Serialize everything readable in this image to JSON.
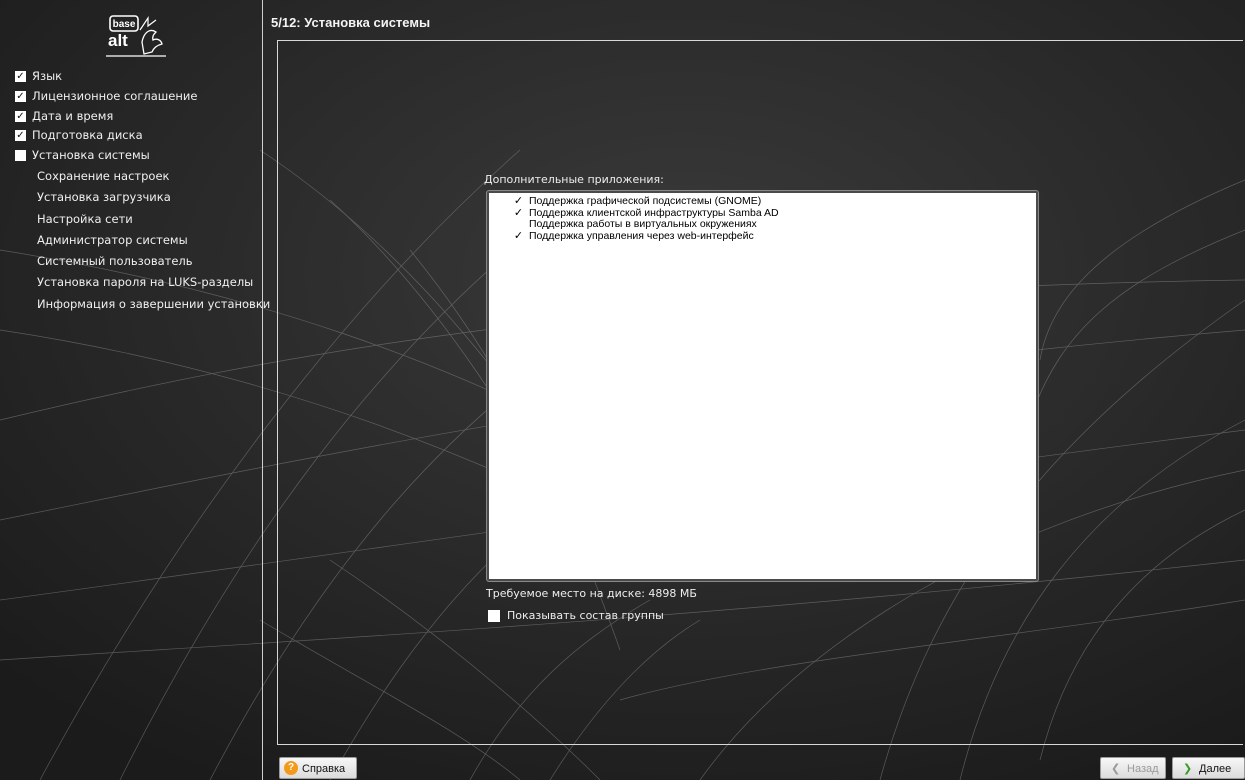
{
  "logo": {
    "line1": "base",
    "line2": "alt"
  },
  "sidebar": {
    "steps": [
      {
        "label": "Язык",
        "state": "done"
      },
      {
        "label": "Лицензионное соглашение",
        "state": "done"
      },
      {
        "label": "Дата и время",
        "state": "done"
      },
      {
        "label": "Подготовка диска",
        "state": "done"
      },
      {
        "label": "Установка системы",
        "state": "current"
      },
      {
        "label": "Сохранение настроек",
        "state": "todo"
      },
      {
        "label": "Установка загрузчика",
        "state": "todo"
      },
      {
        "label": "Настройка сети",
        "state": "todo"
      },
      {
        "label": "Администратор системы",
        "state": "todo"
      },
      {
        "label": "Системный пользователь",
        "state": "todo"
      },
      {
        "label": "Установка пароля на LUKS-разделы",
        "state": "todo"
      },
      {
        "label": "Информация о завершении установки",
        "state": "todo"
      }
    ]
  },
  "header": {
    "title": "5/12: Установка системы"
  },
  "main": {
    "apps_label": "Дополнительные приложения:",
    "apps": [
      {
        "label": "Поддержка графической подсистемы (GNOME)",
        "checked": true
      },
      {
        "label": "Поддержка клиентской инфраструктуры Samba AD",
        "checked": true
      },
      {
        "label": "Поддержка работы в виртуальных окружениях",
        "checked": false
      },
      {
        "label": "Поддержка управления через web-интерфейс",
        "checked": true
      }
    ],
    "disk_space": "Требуемое место на диске: 4898 МБ",
    "show_group_label": "Показывать состав группы",
    "show_group_checked": false
  },
  "footer": {
    "help_label": "Справка",
    "back_label": "Назад",
    "next_label": "Далее"
  },
  "colors": {
    "background": "#222222",
    "help_icon": "#f49a1b",
    "next_arrow": "#3c9b2a"
  }
}
